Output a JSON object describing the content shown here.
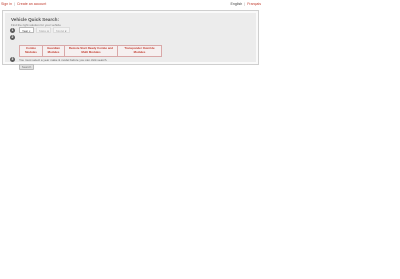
{
  "topbar": {
    "sign_in": "Sign in",
    "create_account": "Create an account",
    "lang_en": "English",
    "lang_fr": "Français"
  },
  "quick_search": {
    "title": "Vehicle Quick Search:",
    "subtitle": "Find the right solution for your vehicle",
    "steps": [
      "1",
      "2",
      "3"
    ],
    "year_select": "Year",
    "make_select": "Make",
    "model_select": "Model",
    "categories": [
      "Combo Modules",
      "Guardian Modules",
      "Remote Start Ready Combo and Multi Modules",
      "Transponder Override Modules"
    ],
    "note": "You must select a year make & model before you can click search.",
    "search_label": "Search"
  },
  "colors": {
    "link": "#c0392b",
    "panel_bg": "#ececec",
    "category_border": "#d9a8a8"
  },
  "icons": {
    "chevron": "chevron-down-icon"
  }
}
